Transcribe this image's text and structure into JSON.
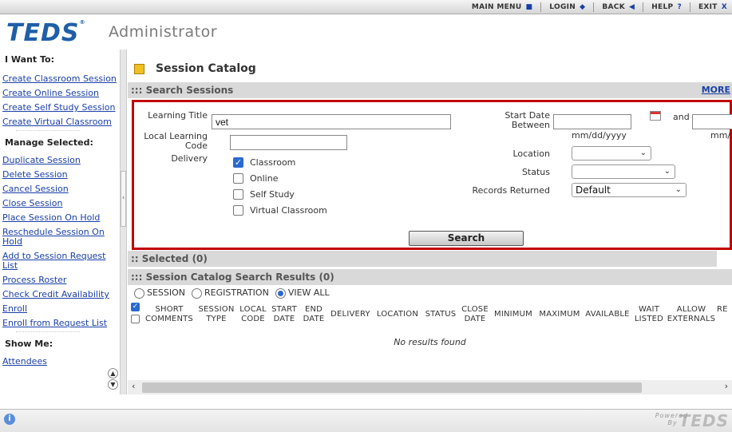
{
  "topnav": {
    "main_menu": "MAIN MENU",
    "login": "LOGIN",
    "back": "BACK",
    "help": "HELP",
    "help_icon": "?",
    "exit": "EXIT",
    "exit_icon": "X"
  },
  "header": {
    "logo": "TEDS",
    "subtitle": "Administrator"
  },
  "sidebar": {
    "want_heading": "I Want To:",
    "want_items": [
      "Create Classroom Session",
      "Create Online Session",
      "Create Self Study Session",
      "Create Virtual Classroom"
    ],
    "manage_heading": "Manage Selected:",
    "manage_items": [
      "Duplicate Session",
      "Delete Session",
      "Cancel Session",
      "Close Session",
      "Place Session On Hold",
      "Reschedule Session On Hold",
      "Add to Session Request List",
      "Process Roster",
      "Check Credit Availability",
      "Enroll",
      "Enroll from Request List"
    ],
    "show_heading": "Show Me:",
    "show_items": [
      "Attendees"
    ]
  },
  "main": {
    "title": "Session Catalog",
    "search_sessions": "::: Search Sessions",
    "more": "MORE",
    "form": {
      "learning_title_label": "Learning Title",
      "learning_title_value": "vet",
      "local_code_label": "Local Learning Code",
      "local_code_value": "",
      "delivery_label": "Delivery",
      "delivery_options": [
        {
          "label": "Classroom",
          "checked": true
        },
        {
          "label": "Online",
          "checked": false
        },
        {
          "label": "Self Study",
          "checked": false
        },
        {
          "label": "Virtual Classroom",
          "checked": false
        }
      ],
      "start_date_label": "Start Date Between",
      "and_label": "and",
      "date_hint": "mm/dd/yyyy",
      "date_hint_2": "mm/",
      "location_label": "Location",
      "location_value": "",
      "status_label": "Status",
      "status_value": "",
      "records_label": "Records Returned",
      "records_value": "Default",
      "search_button": "Search"
    },
    "selected_bar": ":: Selected (0)",
    "results_bar": "::: Session Catalog Search Results (0)",
    "view_modes": [
      {
        "label": "SESSION",
        "selected": false
      },
      {
        "label": "REGISTRATION",
        "selected": false
      },
      {
        "label": "VIEW ALL",
        "selected": true
      }
    ],
    "columns": [
      "SHORT COMMENTS",
      "SESSION TYPE",
      "LOCAL CODE",
      "START DATE",
      "END DATE",
      "DELIVERY",
      "LOCATION",
      "STATUS",
      "CLOSE DATE",
      "MINIMUM",
      "MAXIMUM",
      "AVAILABLE",
      "WAIT LISTED",
      "ALLOW EXTERNALS",
      "RE"
    ],
    "no_results": "No results found"
  },
  "footer": {
    "powered_1": "Powered",
    "powered_2": "By",
    "brand": "TEDS"
  },
  "colors": {
    "accent": "#1a3fa8",
    "highlight_border": "#c00000",
    "bar_gray": "#d9d9d9",
    "logo_blue": "#1f5fa8"
  }
}
